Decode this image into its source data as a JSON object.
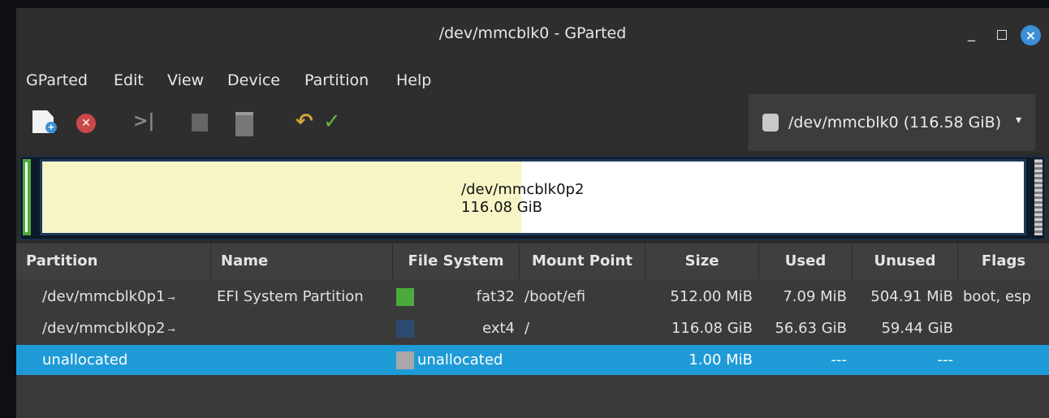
{
  "window": {
    "title": "/dev/mmcblk0 - GParted",
    "min_label": "_",
    "close_label": "×"
  },
  "menu": [
    "GParted",
    "Edit",
    "View",
    "Device",
    "Partition",
    "Help"
  ],
  "toolbar": {
    "icons": [
      "new-icon",
      "delete-icon",
      "resize-move-icon",
      "copy-icon",
      "paste-icon",
      "undo-icon",
      "apply-icon"
    ]
  },
  "device_selector": {
    "label": "/dev/mmcblk0 (116.58 GiB)",
    "arrow": "▾"
  },
  "visual": {
    "partition_name": "/dev/mmcblk0p2",
    "partition_size": "116.08 GiB",
    "used_fraction": 0.488,
    "colors": {
      "used": "#f7f4c6",
      "free": "#ffffff",
      "border": "#1e3a5c",
      "fat32": "#4caa3d",
      "unallocated": "#a8a8a8"
    }
  },
  "table": {
    "headers": [
      "Partition",
      "Name",
      "File System",
      "Mount Point",
      "Size",
      "Used",
      "Unused",
      "Flags"
    ],
    "rows": [
      {
        "partition": "/dev/mmcblk0p1",
        "key": "⊸",
        "name": "EFI System Partition",
        "fs_color": "#4caa3d",
        "filesystem": "fat32",
        "mount": "/boot/efi",
        "size": "512.00 MiB",
        "used": "7.09 MiB",
        "unused": "504.91 MiB",
        "flags": "boot, esp",
        "selected": false
      },
      {
        "partition": "/dev/mmcblk0p2",
        "key": "⊸",
        "name": "",
        "fs_color": "#2c4a6e",
        "filesystem": "ext4",
        "mount": "/",
        "size": "116.08 GiB",
        "used": "56.63 GiB",
        "unused": "59.44 GiB",
        "flags": "",
        "selected": false
      },
      {
        "partition": "unallocated",
        "key": "",
        "name": "",
        "fs_color": "#a8a8a8",
        "filesystem": "unallocated",
        "mount": "",
        "size": "1.00 MiB",
        "used": "---",
        "unused": "---",
        "flags": "",
        "selected": true
      }
    ]
  }
}
